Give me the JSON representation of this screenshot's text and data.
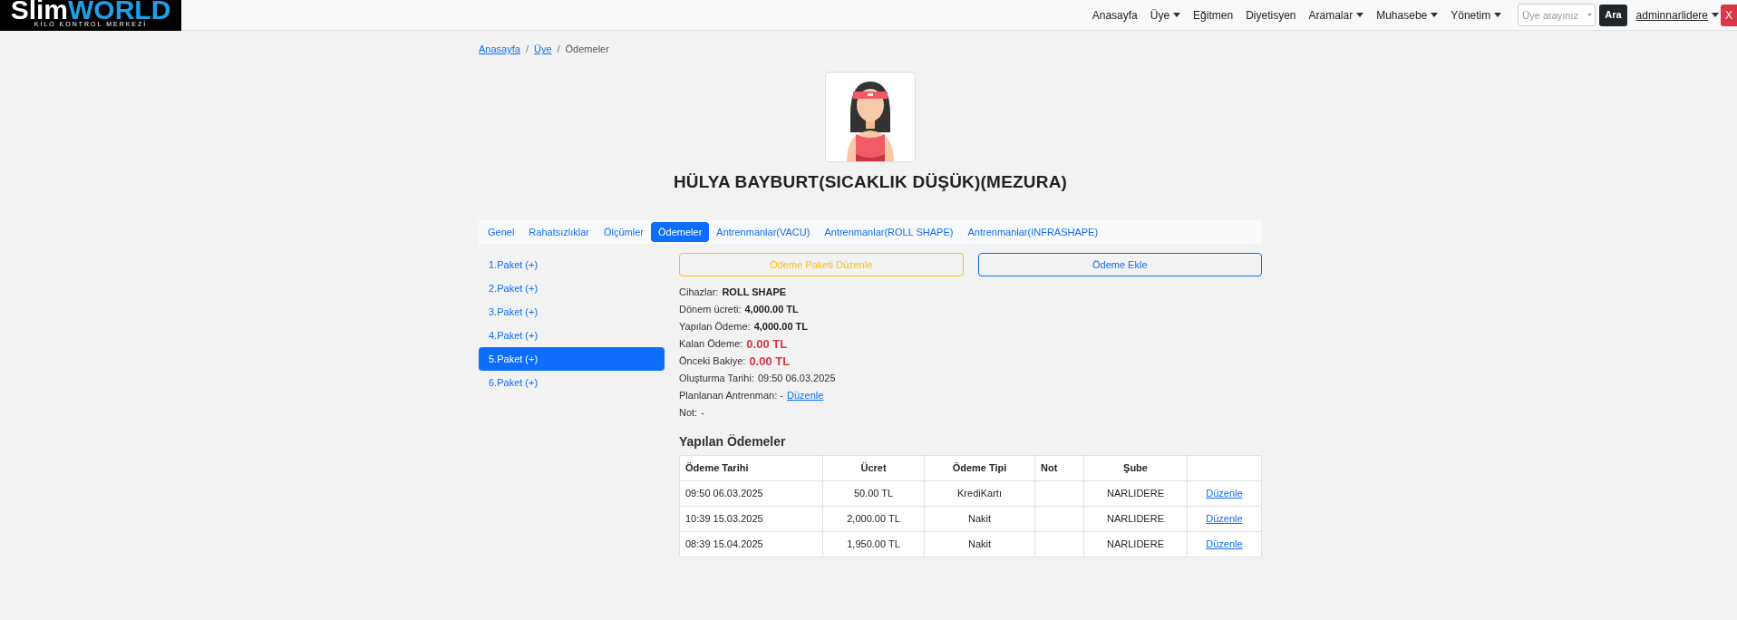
{
  "logo": {
    "name_left": "Slim",
    "name_right": "WORLD",
    "tagline": "KİLO KONTROL MERKEZİ"
  },
  "nav": {
    "items": [
      {
        "label": "Anasayfa",
        "dropdown": false
      },
      {
        "label": "Üye",
        "dropdown": true
      },
      {
        "label": "Eğitmen",
        "dropdown": false
      },
      {
        "label": "Diyetisyen",
        "dropdown": false
      },
      {
        "label": "Aramalar",
        "dropdown": true
      },
      {
        "label": "Muhasebe",
        "dropdown": true
      },
      {
        "label": "Yönetim",
        "dropdown": true
      }
    ],
    "search": {
      "placeholder": "Üye arayınız"
    },
    "search_button": "Ara",
    "user": "adminnarlidere",
    "close_button": "X"
  },
  "breadcrumb_separator": "/",
  "breadcrumb": [
    {
      "label": "Anasayfa",
      "link": true
    },
    {
      "label": "Üye",
      "link": true
    },
    {
      "label": "Ödemeler",
      "link": false
    }
  ],
  "member": {
    "name": "HÜLYA BAYBURT(SICAKLIK DÜŞÜK)(MEZURA)"
  },
  "tabs": [
    {
      "label": "Genel",
      "selected": false
    },
    {
      "label": "Rahatsızlıklar",
      "selected": false
    },
    {
      "label": "Ölçümler",
      "selected": false
    },
    {
      "label": "Ödemeler",
      "selected": true
    },
    {
      "label": "Antrenmanlar(VACU)",
      "selected": false
    },
    {
      "label": "Antrenmanlar(ROLL SHAPE)",
      "selected": false
    },
    {
      "label": "Antrenmanlar(INFRASHAPE)",
      "selected": false
    }
  ],
  "packages": [
    {
      "label": "1.Paket (+)",
      "selected": false
    },
    {
      "label": "2.Paket (+)",
      "selected": false
    },
    {
      "label": "3.Paket (+)",
      "selected": false
    },
    {
      "label": "4.Paket (+)",
      "selected": false
    },
    {
      "label": "5.Paket (+)",
      "selected": true
    },
    {
      "label": "6.Paket (+)",
      "selected": false
    }
  ],
  "actions": [
    {
      "label": "Ödeme Paketi Düzenle",
      "kind": "warning"
    },
    {
      "label": "Ödeme Ekle",
      "kind": "primary"
    }
  ],
  "details": [
    {
      "label": "Cihazlar:",
      "value": "ROLL SHAPE",
      "kind": "bold"
    },
    {
      "label": "Dönem ücreti:",
      "value": "4,000.00 TL",
      "kind": "bold"
    },
    {
      "label": "Yapılan Ödeme:",
      "value": "4,000.00 TL",
      "kind": "bold"
    },
    {
      "label": "Kalan Ödeme:",
      "value": "0.00 TL",
      "kind": "alert"
    },
    {
      "label": "Önceki Bakiye:",
      "value": "0.00 TL",
      "kind": "alert"
    },
    {
      "label": "Oluşturma Tarihi:",
      "value": "09:50 06.03.2025",
      "kind": "plain"
    },
    {
      "label": "Planlanan Antrenman: -",
      "value": "Düzenle",
      "kind": "link"
    },
    {
      "label": "Not:",
      "value": "-",
      "kind": "plain"
    }
  ],
  "payments": {
    "title": "Yapılan Ödemeler",
    "columns": [
      "Ödeme Tarihi",
      "Ücret",
      "Ödeme Tipi",
      "Not",
      "Şube"
    ],
    "rows": [
      {
        "date": "09:50 06.03.2025",
        "amount": "50.00 TL",
        "type": "KrediKartı",
        "branch": "NARLIDERE",
        "action": "Düzenle"
      },
      {
        "date": "10:39 15.03.2025",
        "amount": "2,000.00 TL",
        "type": "Nakit",
        "branch": "NARLIDERE",
        "action": "Düzenle"
      },
      {
        "date": "08:39 15.04.2025",
        "amount": "1,950.00 TL",
        "type": "Nakit",
        "branch": "NARLIDERE",
        "action": "Düzenle"
      }
    ]
  }
}
